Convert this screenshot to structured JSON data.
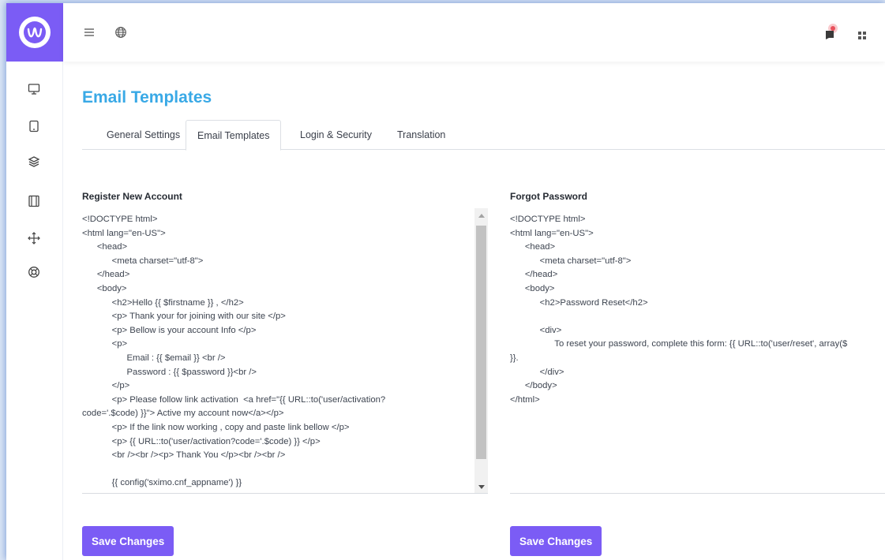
{
  "colors": {
    "accent": "#7b5cf5",
    "title": "#39a9e6",
    "notification": "#e8505b"
  },
  "icons": {
    "brand": "brand-logo-icon",
    "menu": "hamburger-icon",
    "language": "globe-icon",
    "notifications": "flag-icon",
    "apps": "grid-icon",
    "rail": [
      "monitor-icon",
      "tablet-icon",
      "layers-icon",
      "film-icon",
      "move-icon",
      "lifebuoy-icon"
    ]
  },
  "page": {
    "title": "Email Templates"
  },
  "tabs": [
    {
      "label": "General Settings",
      "active": false
    },
    {
      "label": "Email Templates",
      "active": true
    },
    {
      "label": "Login & Security",
      "active": false
    },
    {
      "label": "Translation",
      "active": false
    }
  ],
  "register": {
    "label": "Register New Account",
    "content": "<!DOCTYPE html>\n<html lang=\"en-US\">\n      <head>\n            <meta charset=\"utf-8\">\n      </head>\n      <body>\n            <h2>Hello {{ $firstname }} , </h2>\n            <p> Thank your for joining with our site </p>\n            <p> Bellow is your account Info </p>\n            <p>\n                  Email : {{ $email }} <br />\n                  Password : {{ $password }}<br />\n            </p>\n            <p> Please follow link activation  <a href=\"{{ URL::to('user/activation?\ncode='.$code) }}\"> Active my account now</a></p>\n            <p> If the link now working , copy and paste link bellow </p>\n            <p> {{ URL::to('user/activation?code='.$code) }} </p>\n            <br /><br /><p> Thank You </p><br /><br />\n\n            {{ config('sximo.cnf_appname') }}",
    "button": "Save Changes"
  },
  "forgot": {
    "label": "Forgot Password",
    "content": "<!DOCTYPE html>\n<html lang=\"en-US\">\n      <head>\n            <meta charset=\"utf-8\">\n      </head>\n      <body>\n            <h2>Password Reset</h2>\n\n            <div>\n                  To reset your password, complete this form: {{ URL::to('user/reset', array($\n}}.\n            </div>\n      </body>\n</html>",
    "button": "Save Changes"
  }
}
